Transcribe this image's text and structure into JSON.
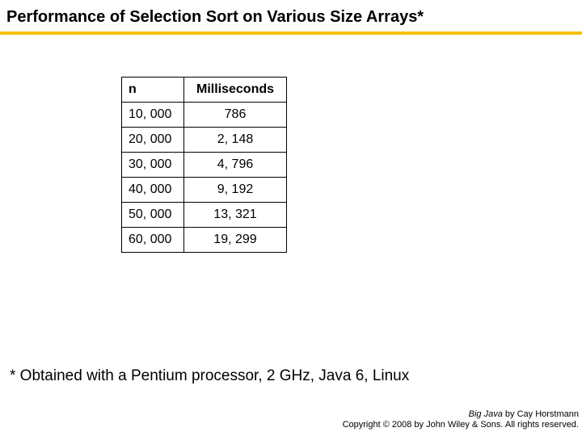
{
  "title": "Performance of Selection Sort on Various Size Arrays*",
  "table": {
    "headers": {
      "n": "n",
      "ms": "Milliseconds"
    },
    "rows": [
      {
        "n": "10, 000",
        "ms": "786"
      },
      {
        "n": "20, 000",
        "ms": "2, 148"
      },
      {
        "n": "30, 000",
        "ms": "4, 796"
      },
      {
        "n": "40, 000",
        "ms": "9, 192"
      },
      {
        "n": "50, 000",
        "ms": "13, 321"
      },
      {
        "n": "60, 000",
        "ms": "19, 299"
      }
    ]
  },
  "footnote": "* Obtained with a Pentium processor, 2 GHz, Java 6, Linux",
  "credit": {
    "book": "Big Java",
    "by": " by Cay Horstmann",
    "copyright": "Copyright © 2008 by John Wiley & Sons. All rights reserved."
  },
  "chart_data": {
    "type": "table",
    "title": "Performance of Selection Sort on Various Size Arrays",
    "columns": [
      "n",
      "Milliseconds"
    ],
    "rows": [
      [
        10000,
        786
      ],
      [
        20000,
        2148
      ],
      [
        30000,
        4796
      ],
      [
        40000,
        9192
      ],
      [
        50000,
        13321
      ],
      [
        60000,
        19299
      ]
    ]
  }
}
